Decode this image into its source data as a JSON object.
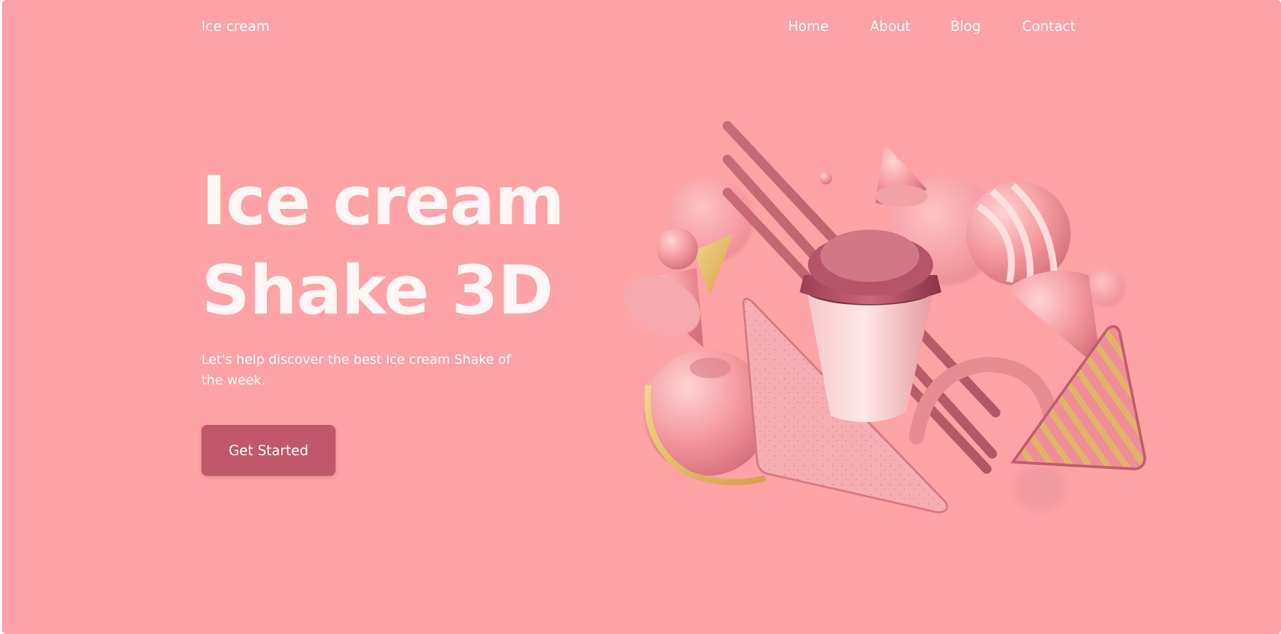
{
  "header": {
    "brand": "Ice cream",
    "nav": [
      "Home",
      "About",
      "Blog",
      "Contact"
    ]
  },
  "hero": {
    "title_line1": "Ice cream",
    "title_line2": "Shake 3D",
    "subtitle": "Let's help discover the best Ice cream Shake of the week.",
    "cta_label": "Get Started"
  },
  "colors": {
    "background": "#fda2a5",
    "button": "#c0576a",
    "text": "#ffffff"
  },
  "illustration": {
    "icon": "ice-cream-shake-3d-illustration"
  }
}
